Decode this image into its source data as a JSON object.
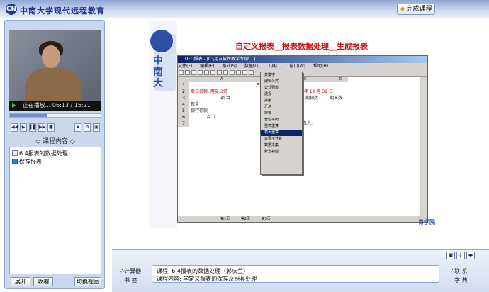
{
  "header": {
    "logo_mark": "CN",
    "title": "中南大学现代远程教育",
    "finish_button": "完成课程"
  },
  "player": {
    "status": "正在播放...",
    "current_time": "06:13",
    "separator": "/",
    "total_time": "15:21",
    "progress_fraction": 0.405
  },
  "toc": {
    "heading": "◇ 课程内容 ◇",
    "items": [
      {
        "label": "6.4报表的数据处理",
        "icon": "page-icon"
      },
      {
        "label": "保存报表",
        "icon": "book-icon"
      }
    ]
  },
  "left_buttons": {
    "expand": "展开",
    "collapse": "收缩",
    "switch_view": "切换视图"
  },
  "slide": {
    "title": "自定义报表__报表数据处理__生成报表",
    "footer": "育学院",
    "side_text": "中南大",
    "screenshot": {
      "window_title": "UFO报表 - [C:\\用友软件教学专用\\...]",
      "menu": [
        "文件(F)",
        "编辑(E)",
        "格式(S)",
        "数据(D)",
        "工具(T)",
        "窗口(W)",
        "帮助(H)"
      ],
      "columns": [
        "A",
        "B",
        "C",
        "D"
      ],
      "rows": [
        {
          "n": "1",
          "cells": [
            "",
            "资产负债表",
            "",
            ""
          ]
        },
        {
          "n": "2",
          "cells": [
            "单位名称: 用友公司",
            "",
            "年 12 月 31 日",
            ""
          ]
        },
        {
          "n": "3",
          "cells": [
            "项 目",
            "",
            "期初数",
            "期末数"
          ]
        },
        {
          "n": "4",
          "cells": [
            "现金",
            "",
            "",
            ""
          ]
        },
        {
          "n": "5",
          "cells": [
            "银行存款",
            "",
            "",
            ""
          ]
        },
        {
          "n": "6",
          "cells": [
            "合 计",
            "",
            "",
            ""
          ]
        },
        {
          "n": "7",
          "cells": [
            "",
            "",
            "制表人:",
            ""
          ]
        }
      ],
      "menu_items": [
        "关键字",
        "编辑公式",
        "公式列表",
        "透视",
        "排序",
        "汇总",
        "审核",
        "舍位平衡",
        "整表重算",
        "表页重算",
        "表页不计算",
        "数据采集",
        "账套初始"
      ],
      "selected_menu_item": "表页重算",
      "sheet_tabs": [
        "第1页",
        "第2页",
        "第3页"
      ]
    }
  },
  "bottom": {
    "calculator": "∴计算器",
    "bookmark": "∴书  签",
    "course_line": "课程: 6.4报表的数据处理（郭庆兰）",
    "content_line": "课程内容: 学定义报表的保存及厨具处理",
    "contact": "∴联  系",
    "dictionary": "∴字  典"
  }
}
